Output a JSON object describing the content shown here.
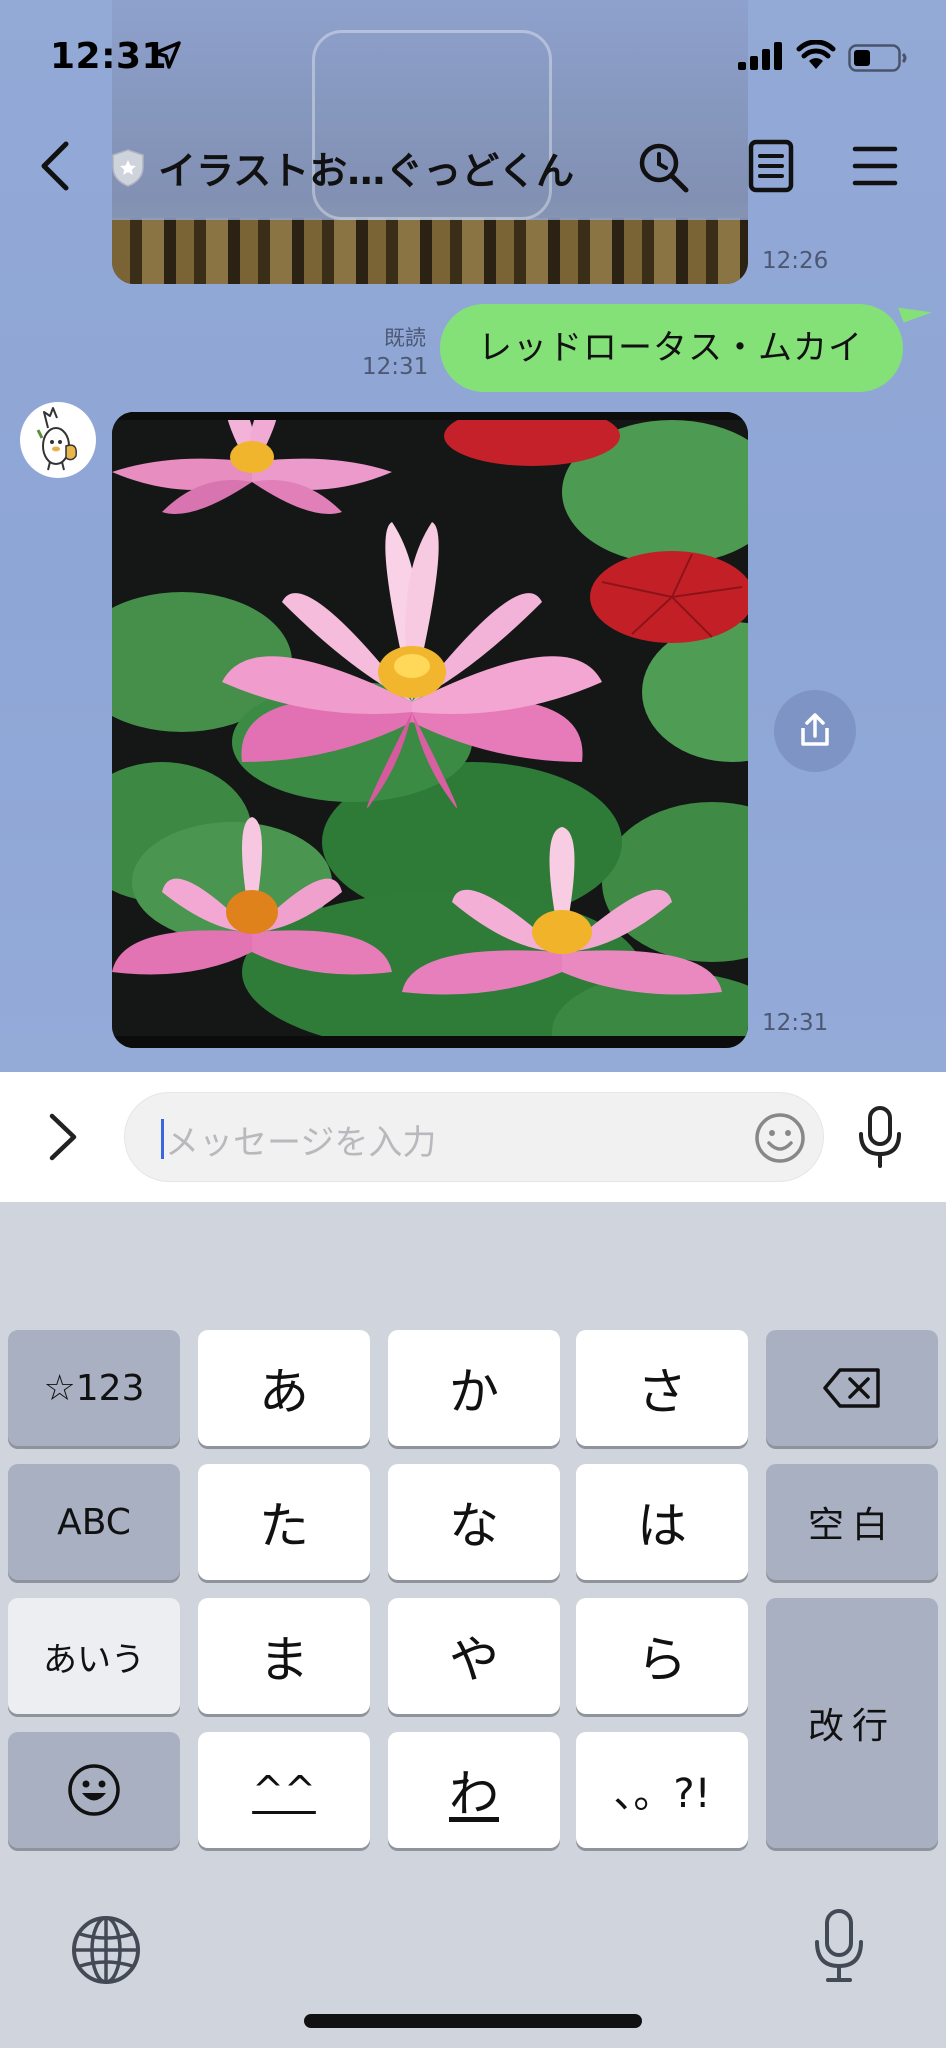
{
  "status_bar": {
    "time": "12:31"
  },
  "header": {
    "title": "イラストお…ぐっどくん"
  },
  "messages": {
    "prev_image_time": "12:26",
    "outgoing": {
      "text": "レッドロータス・ムカイ",
      "read_label": "既読",
      "time": "12:31"
    },
    "incoming_image_time": "12:31"
  },
  "input": {
    "placeholder": "メッセージを入力"
  },
  "keyboard": {
    "row1": [
      "☆123",
      "あ",
      "か",
      "さ"
    ],
    "row2": [
      "ABC",
      "た",
      "な",
      "は",
      "空白"
    ],
    "row3": [
      "あいう",
      "ま",
      "や",
      "ら",
      "改行"
    ],
    "row4": [
      "^^",
      "わ",
      "、。?!"
    ]
  },
  "colors": {
    "chat_bg": "#8ea6d6",
    "bubble_out": "#84e178",
    "keyboard_bg": "#d0d4dd"
  }
}
